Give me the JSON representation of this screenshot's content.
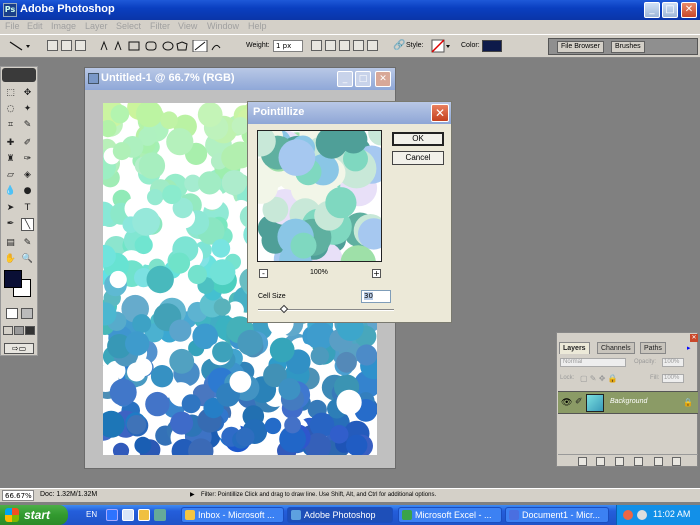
{
  "app": {
    "title": "Adobe Photoshop",
    "icon_label": "Ps"
  },
  "menu": [
    "File",
    "Edit",
    "Image",
    "Layer",
    "Select",
    "Filter",
    "View",
    "Window",
    "Help"
  ],
  "options": {
    "weight_label": "Weight:",
    "weight_value": "1 px",
    "style_label": "Style:",
    "color_label": "Color:",
    "color_value": "#0d1a4a"
  },
  "palette_well": {
    "tabs": [
      "File Browser",
      "Brushes"
    ]
  },
  "document": {
    "title": "Untitled-1 @ 66.7% (RGB)"
  },
  "dialog": {
    "title": "Pointillize",
    "ok_label": "OK",
    "cancel_label": "Cancel",
    "zoom_minus": "-",
    "zoom_plus": "+",
    "zoom": "100%",
    "cell_size_label": "Cell Size",
    "cell_size_value": "30"
  },
  "layers": {
    "tabs": [
      "Layers",
      "Channels",
      "Paths"
    ],
    "blend_mode": "Normal",
    "opacity_label": "Opacity:",
    "opacity_value": "100%",
    "lock_label": "Lock:",
    "fill_label": "Fill:",
    "fill_value": "100%",
    "layer_name": "Background"
  },
  "status": {
    "zoom": "66.67%",
    "doc": "Doc: 1.32M/1.32M",
    "message": "Filter: Pointillize   Click and drag to draw line. Use Shift, Alt, and Ctrl for additional options."
  },
  "taskbar": {
    "start": "start",
    "lang": "EN",
    "tasks": [
      "Inbox - Microsoft ...",
      "Adobe Photoshop",
      "Microsoft Excel - ...",
      "Document1 - Micr..."
    ],
    "time": "11:02 AM"
  }
}
